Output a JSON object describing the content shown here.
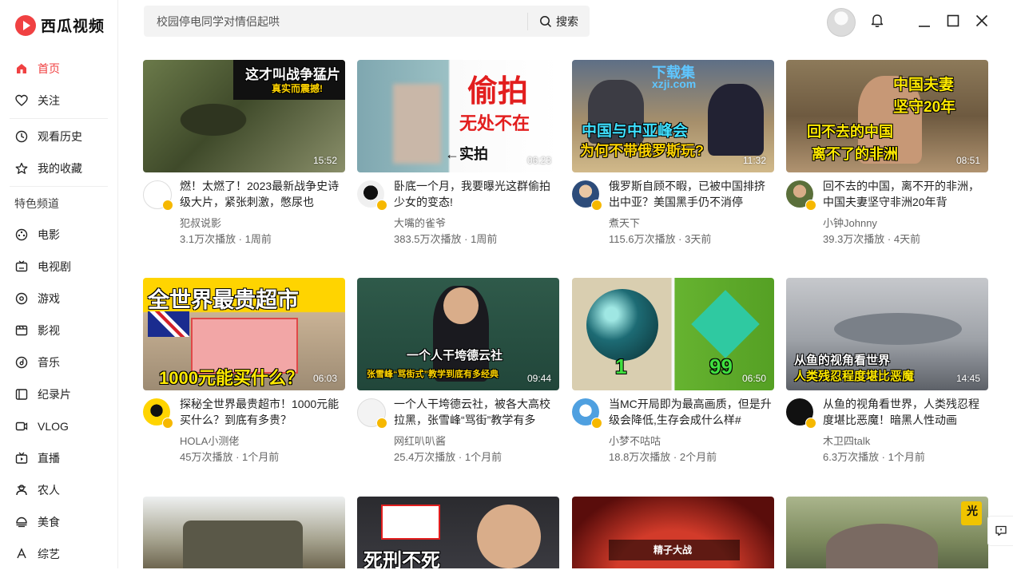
{
  "app": {
    "name": "西瓜视频"
  },
  "search": {
    "placeholder": "校园停电同学对情侣起哄",
    "button": "搜索"
  },
  "sidebar": {
    "items_top": [
      {
        "label": "首页",
        "icon": "home-icon",
        "active": true
      },
      {
        "label": "关注",
        "icon": "heart-icon"
      }
    ],
    "items_mid": [
      {
        "label": "观看历史",
        "icon": "clock-icon"
      },
      {
        "label": "我的收藏",
        "icon": "star-icon"
      }
    ],
    "section_title": "特色频道",
    "channels": [
      {
        "label": "电影",
        "icon": "film-reel-icon"
      },
      {
        "label": "电视剧",
        "icon": "tv-icon"
      },
      {
        "label": "游戏",
        "icon": "gamepad-icon"
      },
      {
        "label": "影视",
        "icon": "clapper-icon"
      },
      {
        "label": "音乐",
        "icon": "music-disc-icon"
      },
      {
        "label": "纪录片",
        "icon": "document-icon"
      },
      {
        "label": "VLOG",
        "icon": "camera-icon"
      },
      {
        "label": "直播",
        "icon": "live-icon"
      },
      {
        "label": "农人",
        "icon": "farmer-icon"
      },
      {
        "label": "美食",
        "icon": "food-icon"
      },
      {
        "label": "综艺",
        "icon": "variety-icon"
      }
    ]
  },
  "colors": {
    "accent": "#f04142",
    "verified": "#f6b800"
  },
  "videos": [
    {
      "title": "燃！太燃了！2023最新战争史诗级大片，紧张刺激，憋尿也",
      "author": "犯叔说影",
      "stats": "3.1万次播放 · 1周前",
      "duration": "15:52",
      "caption": "这才叫战争猛片",
      "caption2": "真实而震撼!"
    },
    {
      "title": "卧底一个月，我要曝光这群偷拍少女的变态!",
      "author": "大嘴的雀爷",
      "stats": "383.5万次播放 · 1周前",
      "duration": "06:23",
      "caption": "偷拍",
      "caption2": "无处不在",
      "caption3": "←实拍"
    },
    {
      "title": "俄罗斯自顾不暇，已被中国排挤出中亚？美国黑手仍不消停",
      "author": "煮天下",
      "stats": "115.6万次播放 · 3天前",
      "duration": "11:32",
      "caption": "中国与中亚峰会",
      "caption2": "为何不带俄罗斯玩?",
      "watermark": "下载集",
      "watermark2": "xzji.com"
    },
    {
      "title": "回不去的中国，离不开的非洲，中国夫妻坚守非洲20年背",
      "author": "小钟Johnny",
      "stats": "39.3万次播放 · 4天前",
      "duration": "08:51",
      "caption": "中国夫妻",
      "caption2": "坚守20年",
      "caption3": "回不去的中国",
      "caption4": "离不了的非洲"
    },
    {
      "title": "探秘全世界最贵超市！1000元能买什么？到底有多贵？",
      "author": "HOLA小测佬",
      "stats": "45万次播放 · 1个月前",
      "duration": "06:03",
      "caption": "全世界最贵超市",
      "caption2": "1000元能买什么？"
    },
    {
      "title": "一个人干垮德云社，被各大高校拉黑，张雪峰“骂街”教学有多",
      "author": "网红叭叭酱",
      "stats": "25.4万次播放 · 1个月前",
      "duration": "09:44",
      "caption": "一个人干垮德云社",
      "caption2": "张雪峰“骂街式”教学到底有多经典"
    },
    {
      "title": "当MC开局即为最高画质，但是升级会降低,生存会成什么样#",
      "author": "小梦不咕咕",
      "stats": "18.8万次播放 · 2个月前",
      "duration": "06:50",
      "caption": "1",
      "caption2": "99"
    },
    {
      "title": "从鱼的视角看世界，人类残忍程度堪比恶魔！暗黑人性动画",
      "author": "木卫四talk",
      "stats": "6.3万次播放 · 1个月前",
      "duration": "14:45",
      "caption": "从鱼的视角看世界",
      "caption2": "人类残忍程度堪比恶魔"
    },
    {
      "title": "",
      "author": "",
      "stats": "",
      "duration": ""
    },
    {
      "title": "",
      "author": "",
      "stats": "",
      "duration": "",
      "caption": "死刑不死"
    },
    {
      "title": "",
      "author": "",
      "stats": "",
      "duration": "",
      "caption": "精子大战"
    },
    {
      "title": "",
      "author": "",
      "stats": "",
      "duration": "",
      "caption": "光"
    }
  ]
}
